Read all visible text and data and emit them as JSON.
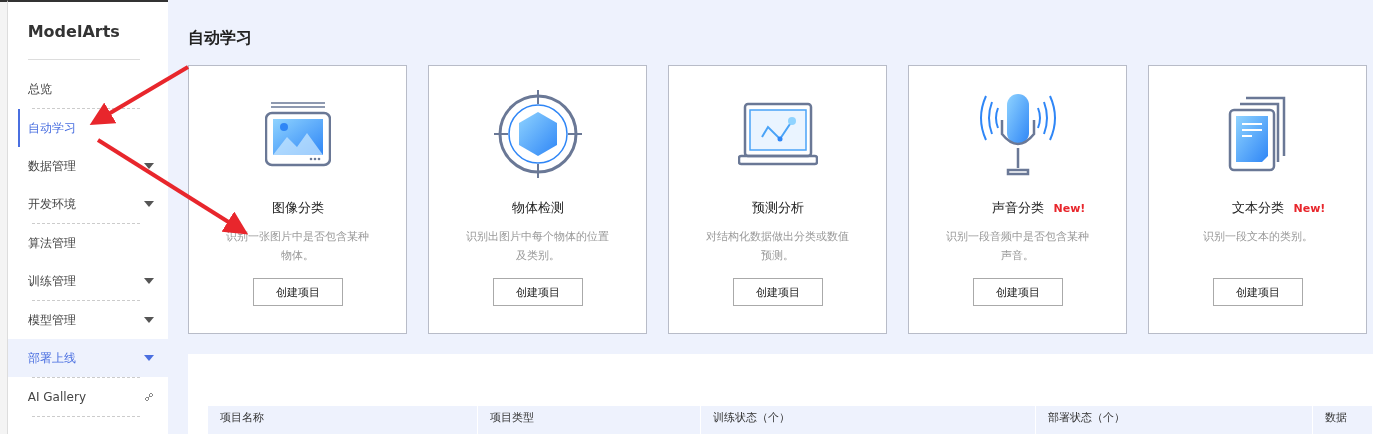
{
  "sidebar": {
    "title": "ModelArts",
    "items": [
      {
        "label": "总览",
        "kind": "plain",
        "selected": false,
        "highlighted": false,
        "separator": true
      },
      {
        "label": "自动学习",
        "kind": "plain",
        "selected": true,
        "highlighted": false,
        "separator": false
      },
      {
        "label": "数据管理",
        "kind": "caret",
        "selected": false,
        "highlighted": false,
        "separator": false
      },
      {
        "label": "开发环境",
        "kind": "caret",
        "selected": false,
        "highlighted": false,
        "separator": true
      },
      {
        "label": "算法管理",
        "kind": "plain",
        "selected": false,
        "highlighted": false,
        "separator": false
      },
      {
        "label": "训练管理",
        "kind": "caret",
        "selected": false,
        "highlighted": false,
        "separator": true
      },
      {
        "label": "模型管理",
        "kind": "caret",
        "selected": false,
        "highlighted": false,
        "separator": false
      },
      {
        "label": "部署上线",
        "kind": "caret",
        "selected": false,
        "highlighted": true,
        "separator": true
      },
      {
        "label": "AI Gallery",
        "kind": "link",
        "selected": false,
        "highlighted": false,
        "separator": true
      }
    ]
  },
  "page_title": "自动学习",
  "cards": [
    {
      "title": "图像分类",
      "description": "识别一张图片中是否包含某种物体。",
      "button": "创建项目"
    },
    {
      "title": "物体检测",
      "description": "识别出图片中每个物体的位置及类别。",
      "button": "创建项目"
    },
    {
      "title": "预测分析",
      "description": "对结构化数据做出分类或数值预测。",
      "button": "创建项目"
    },
    {
      "title": "声音分类",
      "badge": "New!",
      "description": "识别一段音频中是否包含某种声音。",
      "button": "创建项目"
    },
    {
      "title": "文本分类",
      "badge": "New!",
      "description": "识别一段文本的类别。",
      "button": "创建项目"
    }
  ],
  "table": {
    "columns": [
      "项目名称",
      "项目类型",
      "训练状态（个）",
      "部署状态（个）",
      "数据"
    ]
  }
}
